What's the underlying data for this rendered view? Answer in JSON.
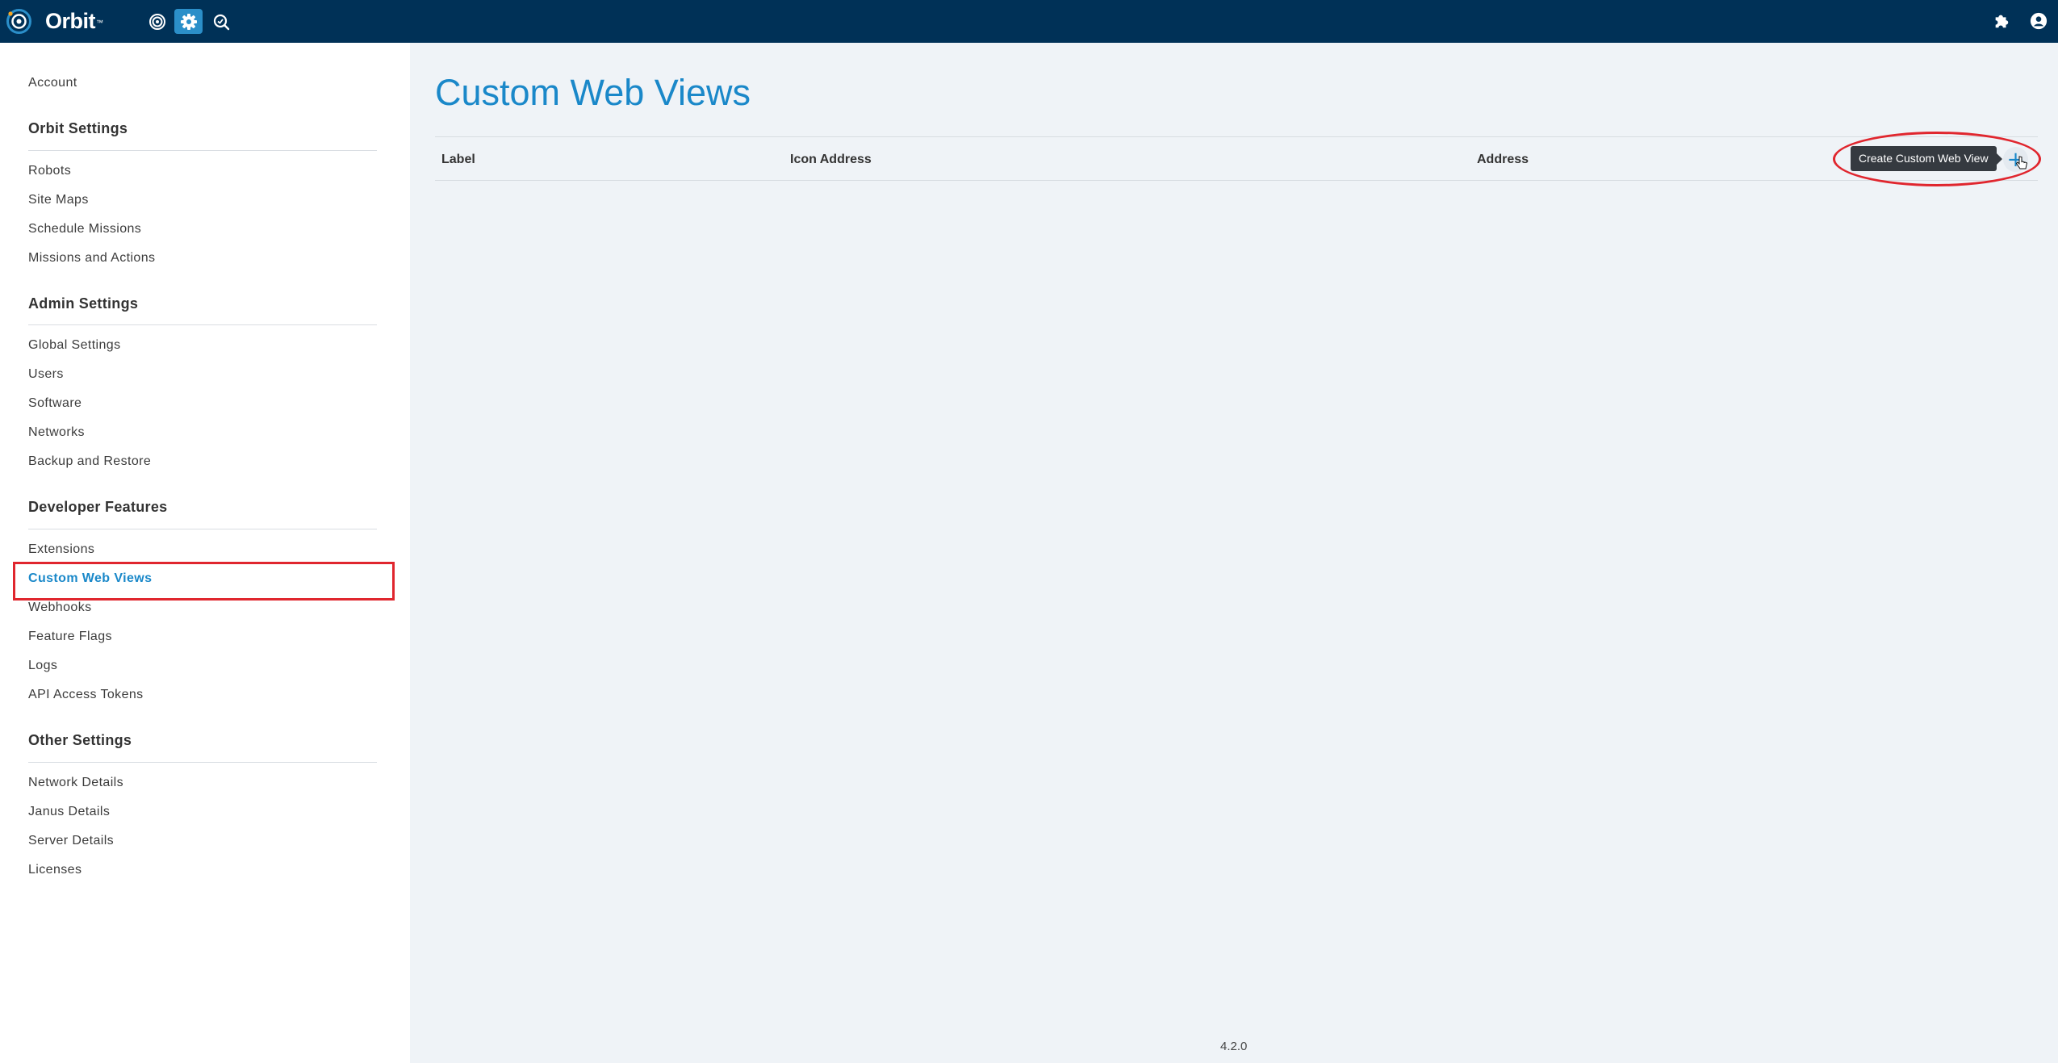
{
  "app": {
    "name": "Orbit",
    "trademark": "™"
  },
  "topbar": {
    "nav_icons": [
      "target-icon",
      "gear-icon",
      "search-icon"
    ],
    "right_icons": [
      "puzzle-icon",
      "user-icon"
    ]
  },
  "sidebar": {
    "account": "Account",
    "sections": [
      {
        "title": "Orbit Settings",
        "items": [
          "Robots",
          "Site Maps",
          "Schedule Missions",
          "Missions and Actions"
        ]
      },
      {
        "title": "Admin Settings",
        "items": [
          "Global Settings",
          "Users",
          "Software",
          "Networks",
          "Backup and Restore"
        ]
      },
      {
        "title": "Developer Features",
        "items": [
          "Extensions",
          "Custom Web Views",
          "Webhooks",
          "Feature Flags",
          "Logs",
          "API Access Tokens"
        ]
      },
      {
        "title": "Other Settings",
        "items": [
          "Network Details",
          "Janus Details",
          "Server Details",
          "Licenses"
        ]
      }
    ],
    "active_item": "Custom Web Views"
  },
  "main": {
    "title": "Custom Web Views",
    "columns": [
      "Label",
      "Icon Address",
      "Address"
    ],
    "add_tooltip": "Create Custom Web View",
    "add_icon": "+"
  },
  "footer": {
    "version": "4.2.0"
  },
  "colors": {
    "topbar": "#003157",
    "accent": "#1a88c9",
    "highlight": "#e0262e",
    "background": "#eff3f7"
  }
}
